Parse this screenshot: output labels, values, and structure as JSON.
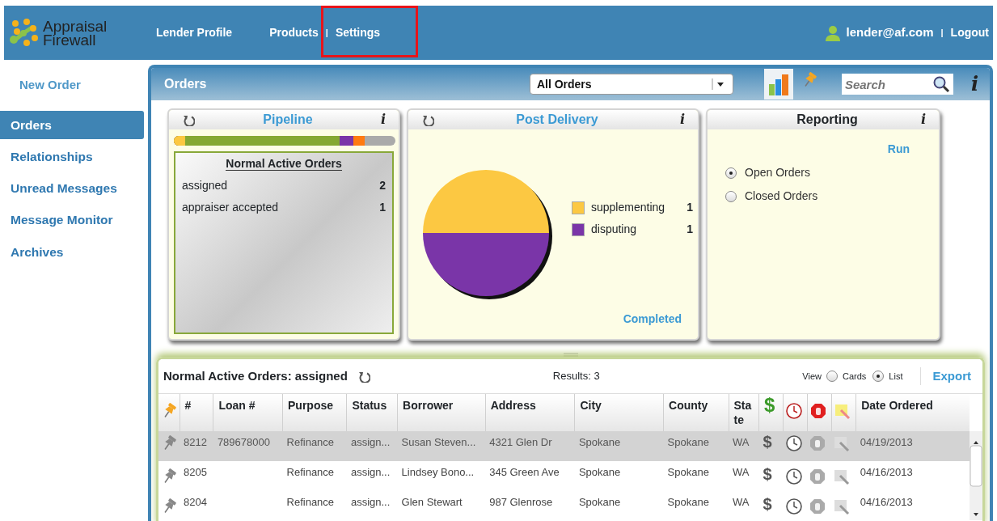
{
  "header": {
    "logo": [
      "Appraisal",
      "Firewall"
    ],
    "nav": [
      {
        "label": "Lender Profile",
        "kind": "link"
      },
      {
        "label": "Products",
        "kind": "link"
      },
      {
        "label": "|",
        "kind": "sep"
      },
      {
        "label": "Settings",
        "kind": "link"
      }
    ],
    "user": "lender@af.com",
    "user_sep": "|",
    "logout": "Logout"
  },
  "sidebar": {
    "items": [
      {
        "label": "New Order",
        "kind": "action",
        "selected": false
      },
      {
        "label": "Orders",
        "kind": "item",
        "selected": true
      },
      {
        "label": "Relationships",
        "kind": "item",
        "selected": false
      },
      {
        "label": "Unread Messages",
        "kind": "item",
        "selected": false
      },
      {
        "label": "Message Monitor",
        "kind": "item",
        "selected": false
      },
      {
        "label": "Archives",
        "kind": "item",
        "selected": false
      }
    ]
  },
  "toolbar": {
    "title": "Orders",
    "filter": "All Orders",
    "views": [
      {
        "kind": "chart",
        "selected": true
      },
      {
        "kind": "pin",
        "selected": false
      }
    ],
    "search": {
      "placeholder": "Search"
    },
    "info": "i"
  },
  "pipeline": {
    "title": "Pipeline",
    "info": "i",
    "box_title": "Normal Active Orders",
    "rows": [
      {
        "label": "assigned",
        "count": "2"
      },
      {
        "label": "appraiser accepted",
        "count": "1"
      }
    ]
  },
  "post_delivery": {
    "title": "Post Delivery",
    "info": "i",
    "link": "Completed",
    "chart_data": {
      "type": "pie",
      "categories": [
        "supplementing",
        "disputing"
      ],
      "series": [
        {
          "values": [
            50,
            50
          ]
        }
      ],
      "colors": [
        "#fcc842",
        "#7a35a8"
      ],
      "legend": "right"
    },
    "legend_counts": [
      "1",
      "1"
    ]
  },
  "reporting": {
    "title": "Reporting",
    "info": "i",
    "run": "Run",
    "options": [
      {
        "label": "Open Orders",
        "selected": true
      },
      {
        "label": "Closed Orders",
        "selected": false
      }
    ]
  },
  "grid": {
    "title": "Normal Active Orders: assigned",
    "results": "Results: 3",
    "view_label": "View",
    "views": [
      {
        "label": "Cards",
        "selected": false
      },
      {
        "label": "List",
        "selected": true
      }
    ],
    "export": "Export",
    "columns": [
      {
        "kind": "pin"
      },
      {
        "label": "#",
        "kind": "text"
      },
      {
        "label": "Loan #",
        "kind": "text"
      },
      {
        "label": "Purpose",
        "kind": "text"
      },
      {
        "label": "Status",
        "kind": "text"
      },
      {
        "label": "Borrower",
        "kind": "text"
      },
      {
        "label": "Address",
        "kind": "text"
      },
      {
        "label": "City",
        "kind": "text"
      },
      {
        "label": "County",
        "kind": "text"
      },
      {
        "label": "State",
        "kind": "text"
      },
      {
        "label": "$",
        "kind": "money"
      },
      {
        "kind": "clock"
      },
      {
        "kind": "stop"
      },
      {
        "kind": "note"
      },
      {
        "label": "Date Ordered",
        "kind": "text"
      }
    ],
    "rows": [
      {
        "selected": true,
        "cells": [
          null,
          "8212",
          "789678000",
          "Refinance",
          "assign...",
          "Susan Steven...",
          "4321 Glen Dr",
          "Spokane",
          "Spokane",
          "WA",
          "$",
          null,
          null,
          null,
          "04/19/2013"
        ]
      },
      {
        "selected": false,
        "cells": [
          null,
          "8205",
          null,
          "Refinance",
          "assign...",
          "Lindsey Bono...",
          "345 Green Ave",
          "Spokane",
          "Spokane",
          "WA",
          "$",
          null,
          null,
          null,
          "04/16/2013"
        ]
      },
      {
        "selected": false,
        "cells": [
          null,
          "8204",
          null,
          "Refinance",
          "assign...",
          "Glen Stewart",
          "987 Glenrose",
          "Spokane",
          "Spokane",
          "WA",
          "$",
          null,
          null,
          null,
          "04/16/2013"
        ]
      }
    ]
  }
}
